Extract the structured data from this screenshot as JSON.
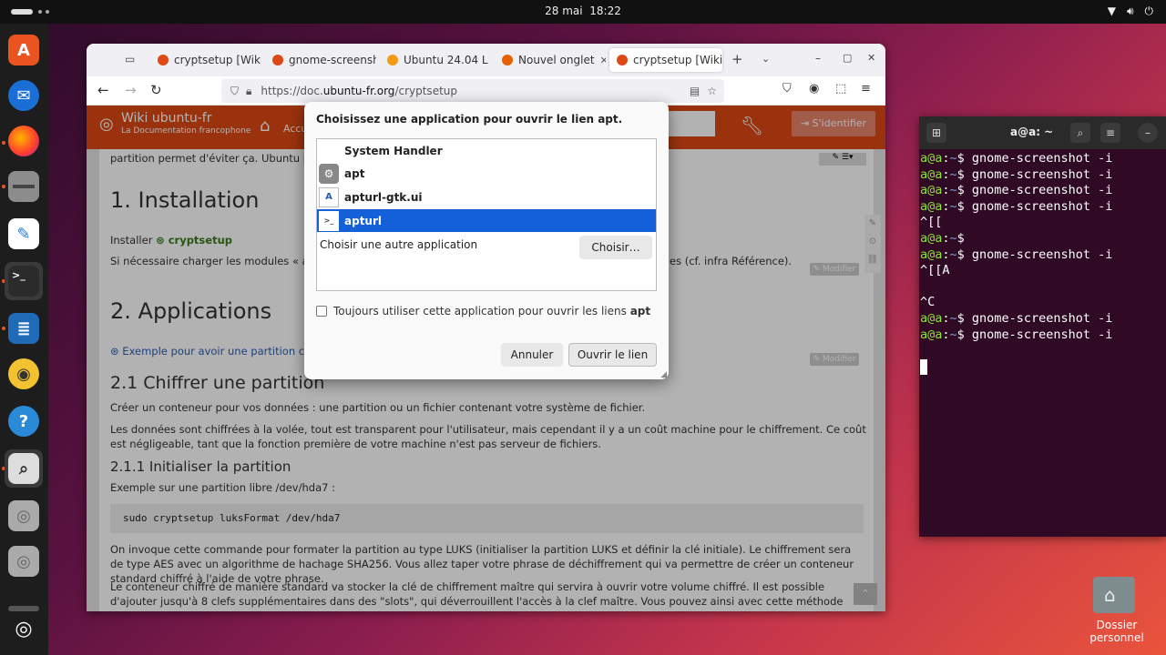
{
  "topbar": {
    "date": "28 mai",
    "time": "18:22",
    "wifi_icon": "wifi-icon",
    "volume_icon": "volume-icon",
    "power_icon": "power-icon"
  },
  "dock": {
    "items": [
      "ubuntu-software",
      "thunderbird",
      "firefox",
      "files",
      "text-editor",
      "terminal",
      "libreoffice-writer",
      "rhythmbox",
      "help",
      "screenshot",
      "disk",
      "disk",
      "apps"
    ]
  },
  "browser": {
    "tabs": [
      {
        "label": "cryptsetup [Wiki"
      },
      {
        "label": "gnome-screensh"
      },
      {
        "label": "Ubuntu 24.04 L"
      },
      {
        "label": "Nouvel onglet"
      },
      {
        "label": "cryptsetup [Wiki"
      }
    ],
    "url_scheme": "https://doc.",
    "url_host": "ubuntu-fr.org",
    "url_path": "/cryptsetup",
    "wiki": {
      "title": "Wiki ubuntu-fr",
      "subtitle": "La Documentation francophone",
      "accueil": "Accu",
      "login": "S'identifier"
    },
    "page": {
      "intro": "partition permet d'éviter ça. Ubuntu intég",
      "h_install": "1. Installation",
      "install_text": "Installer",
      "install_pkg": "cryptsetup",
      "modules_text": "Si nécessaire charger les modules « aes-i58",
      "modules_text2": "es (cf. infra Référence).",
      "modifier": "Modifier",
      "h_apps": "2. Applications",
      "example_link": "Exemple pour avoir une partition chiffré",
      "h_chiffrer": "2.1 Chiffrer une partition",
      "p1": "Créer un conteneur pour vos données : une partition ou un fichier contenant votre système de fichier.",
      "p2": "Les données sont chiffrées à la volée, tout est transparent pour l'utilisateur, mais cependant il y a un coût machine pour le chiffrement. Ce coût est négligeable, tant que la fonction première de votre machine n'est pas serveur de fichiers.",
      "h_init": "2.1.1 Initialiser la partition",
      "p3": "Exemple sur une partition libre /dev/hda7 :",
      "code": "sudo cryptsetup luksFormat  /dev/hda7",
      "p4": "On invoque cette commande pour formater la partition au type LUKS (initialiser la partition LUKS et définir la clé initiale). Le chiffrement sera de type AES avec un algorithme de hachage SHA256. Vous allez taper votre phrase de déchiffrement qui va permettre de créer un conteneur standard chiffré à l'aide de votre phrase.",
      "p5": "Le conteneur chiffré de manière standard va stocker la clé de chiffrement maître qui servira à ouvrir votre volume chiffré. Il est possible d'ajouter jusqu'à 8 clefs supplémentaires dans des \"slots\", qui déverrouillent l'accès à la clef maître. Vous pouvez ainsi avec cette méthode avoir plusieurs utilisateurs qui vont chacun ouvrir"
    }
  },
  "dialog": {
    "title": "Choisissez une application pour ouvrir le lien apt.",
    "items": [
      {
        "label": "System Handler",
        "icon": ""
      },
      {
        "label": "apt",
        "icon": "gear-icon"
      },
      {
        "label": "apturl-gtk.ui",
        "icon": "text-file-icon"
      },
      {
        "label": "apturl",
        "icon": "terminal-file-icon"
      }
    ],
    "other_app": "Choisir une autre application",
    "choose_btn": "Choisir…",
    "always_label": "Toujours utiliser cette application pour ouvrir les liens ",
    "always_bold": "apt",
    "cancel": "Annuler",
    "open": "Ouvrir le lien"
  },
  "terminal": {
    "title": "a@a: ~",
    "lines": [
      {
        "user": "a@a",
        "path": "~",
        "cmd": " gnome-screenshot -i"
      },
      {
        "user": "a@a",
        "path": "~",
        "cmd": " gnome-screenshot -i"
      },
      {
        "user": "a@a",
        "path": "~",
        "cmd": " gnome-screenshot -i"
      },
      {
        "user": "a@a",
        "path": "~",
        "cmd": " gnome-screenshot -i"
      },
      {
        "raw": "^[["
      },
      {
        "user": "a@a",
        "path": "~",
        "cmd": ""
      },
      {
        "user": "a@a",
        "path": "~",
        "cmd": " gnome-screenshot -i"
      },
      {
        "raw": "^[[A"
      },
      {
        "raw": ""
      },
      {
        "raw": "^C"
      },
      {
        "user": "a@a",
        "path": "~",
        "cmd": " gnome-screenshot -i"
      },
      {
        "user": "a@a",
        "path": "~",
        "cmd": " gnome-screenshot -i"
      }
    ]
  },
  "desktop": {
    "home_label": "Dossier personnel"
  }
}
